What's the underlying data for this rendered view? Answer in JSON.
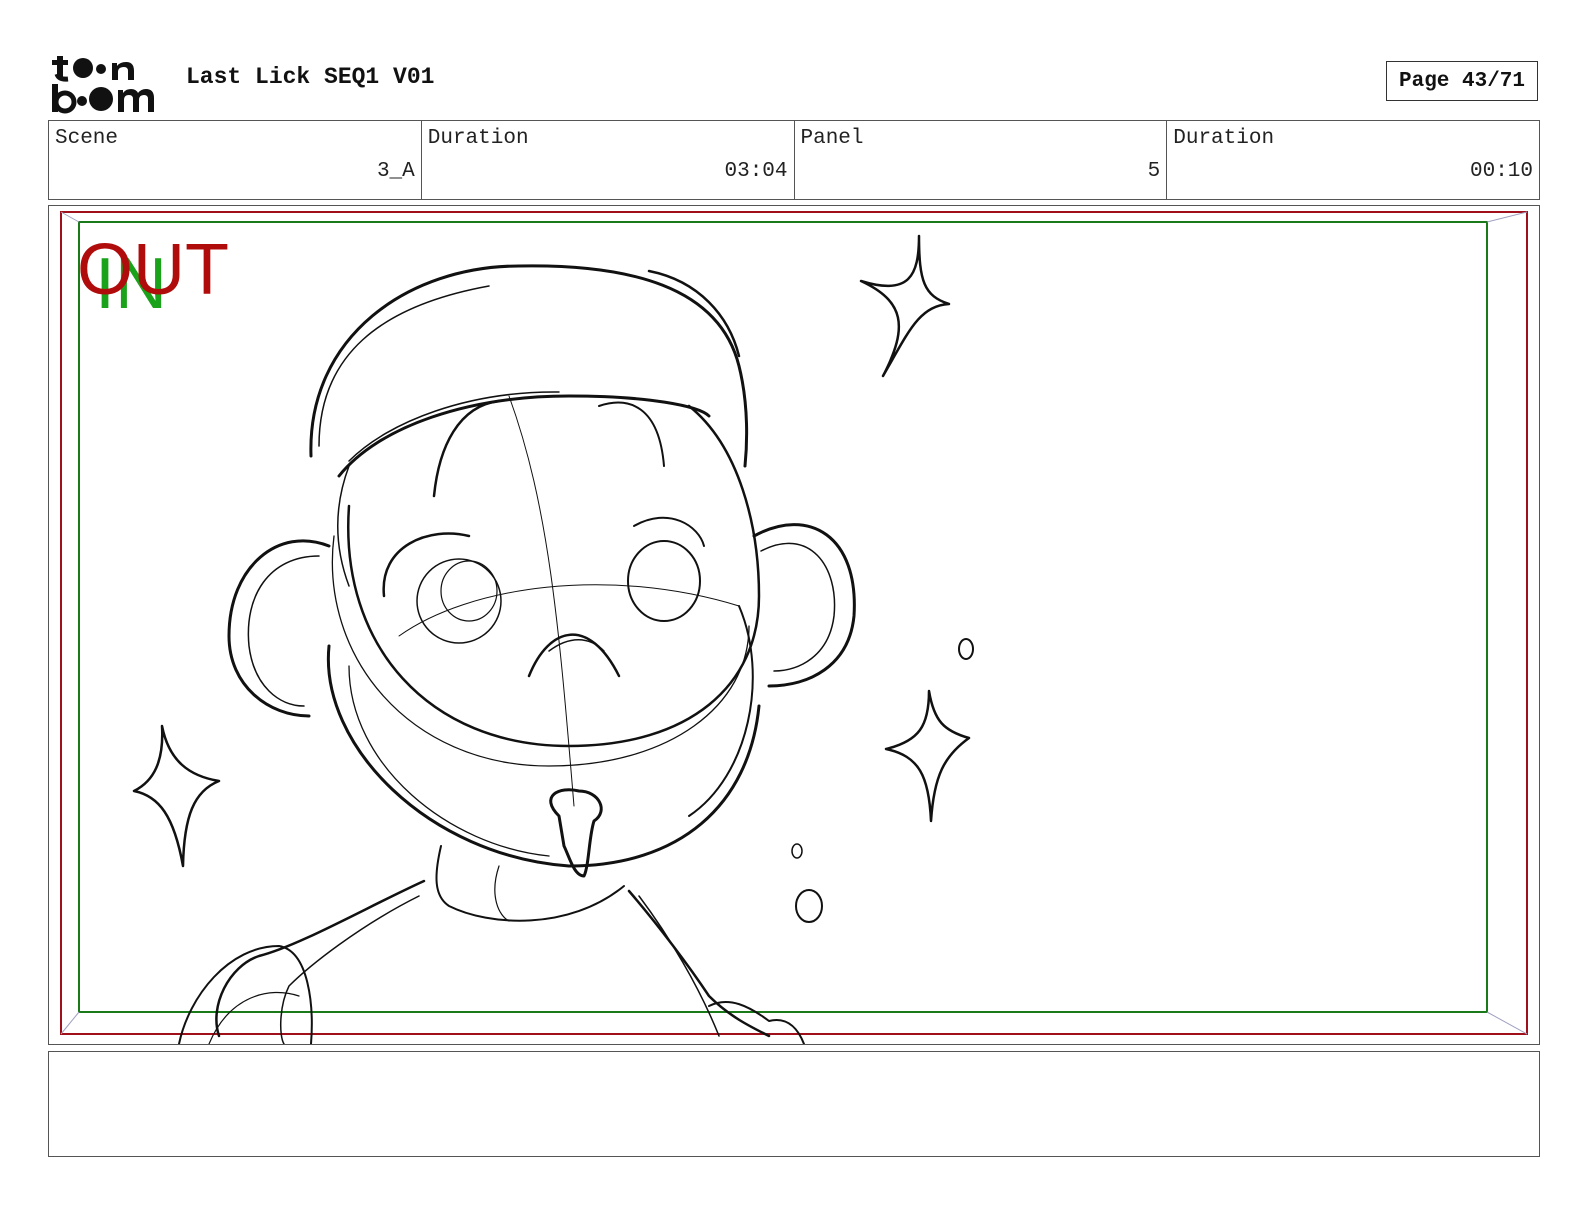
{
  "header": {
    "logo_text": "toon boom",
    "title": "Last Lick SEQ1 V01",
    "page_label": "Page 43/71"
  },
  "info": {
    "scene_label": "Scene",
    "scene_value": "3_A",
    "scene_duration_label": "Duration",
    "scene_duration_value": "03:04",
    "panel_label": "Panel",
    "panel_value": "5",
    "panel_duration_label": "Duration",
    "panel_duration_value": "00:10"
  },
  "panel": {
    "in_marker": "IN",
    "out_marker": "OUT",
    "safe_frame_color": "#1a7a1a",
    "outer_frame_color": "#a0101a"
  },
  "caption": {
    "text": ""
  }
}
